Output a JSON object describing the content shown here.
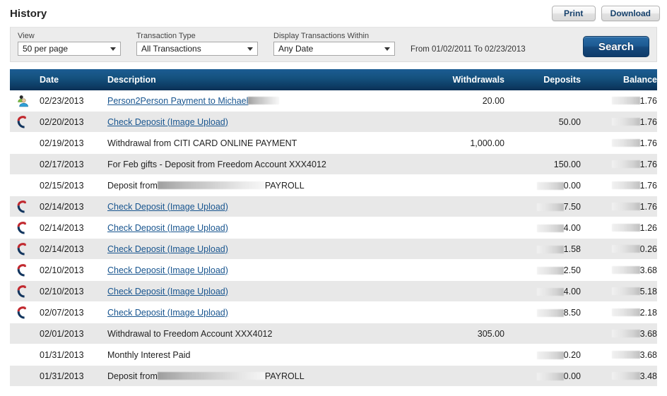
{
  "header": {
    "title": "History",
    "print_label": "Print",
    "download_label": "Download"
  },
  "filters": {
    "view": {
      "label": "View",
      "value": "50 per page"
    },
    "transaction_type": {
      "label": "Transaction Type",
      "value": "All Transactions"
    },
    "display_within": {
      "label": "Display Transactions Within",
      "value": "Any Date"
    },
    "date_range": "From 01/02/2011 To 02/23/2013",
    "search_label": "Search"
  },
  "table": {
    "columns": {
      "date": "Date",
      "description": "Description",
      "withdrawals": "Withdrawals",
      "deposits": "Deposits",
      "balance": "Balance"
    },
    "rows": [
      {
        "icon": "person2person-icon",
        "date": "02/23/2013",
        "description": "Person2Person Payment to Michael",
        "description_redacted": true,
        "is_link": true,
        "withdrawal": "20.00",
        "deposit": "",
        "deposit_redacted": false,
        "balance": "1.76",
        "balance_redacted": true,
        "stripe": "plain"
      },
      {
        "icon": "check-deposit-icon",
        "date": "02/20/2013",
        "description": "Check Deposit (Image Upload)",
        "description_redacted": false,
        "is_link": true,
        "withdrawal": "",
        "deposit": "50.00",
        "deposit_redacted": false,
        "balance": "1.76",
        "balance_redacted": true,
        "stripe": "alt"
      },
      {
        "icon": "",
        "date": "02/19/2013",
        "description": "Withdrawal from CITI CARD ONLINE PAYMENT",
        "description_redacted": false,
        "is_link": false,
        "withdrawal": "1,000.00",
        "deposit": "",
        "deposit_redacted": false,
        "balance": "1.76",
        "balance_redacted": true,
        "stripe": "plain"
      },
      {
        "icon": "",
        "date": "02/17/2013",
        "description": "For Feb gifts - Deposit from Freedom Account XXX4012",
        "description_redacted": false,
        "is_link": false,
        "withdrawal": "",
        "deposit": "150.00",
        "deposit_redacted": false,
        "balance": "1.76",
        "balance_redacted": true,
        "stripe": "alt"
      },
      {
        "icon": "",
        "date": "02/15/2013",
        "description": "Deposit from",
        "description_suffix": "PAYROLL",
        "description_redacted": true,
        "is_link": false,
        "withdrawal": "",
        "deposit": "0.00",
        "deposit_redacted": true,
        "balance": "1.76",
        "balance_redacted": true,
        "stripe": "plain"
      },
      {
        "icon": "check-deposit-icon",
        "date": "02/14/2013",
        "description": "Check Deposit (Image Upload)",
        "description_redacted": false,
        "is_link": true,
        "withdrawal": "",
        "deposit": "7.50",
        "deposit_redacted": true,
        "balance": "1.76",
        "balance_redacted": true,
        "stripe": "alt"
      },
      {
        "icon": "check-deposit-icon",
        "date": "02/14/2013",
        "description": "Check Deposit (Image Upload)",
        "description_redacted": false,
        "is_link": true,
        "withdrawal": "",
        "deposit": "4.00",
        "deposit_redacted": true,
        "balance": "1.26",
        "balance_redacted": true,
        "stripe": "plain"
      },
      {
        "icon": "check-deposit-icon",
        "date": "02/14/2013",
        "description": "Check Deposit (Image Upload)",
        "description_redacted": false,
        "is_link": true,
        "withdrawal": "",
        "deposit": "1.58",
        "deposit_redacted": true,
        "balance": "0.26",
        "balance_redacted": true,
        "stripe": "alt"
      },
      {
        "icon": "check-deposit-icon",
        "date": "02/10/2013",
        "description": "Check Deposit (Image Upload)",
        "description_redacted": false,
        "is_link": true,
        "withdrawal": "",
        "deposit": "2.50",
        "deposit_redacted": true,
        "balance": "3.68",
        "balance_redacted": true,
        "stripe": "plain"
      },
      {
        "icon": "check-deposit-icon",
        "date": "02/10/2013",
        "description": "Check Deposit (Image Upload)",
        "description_redacted": false,
        "is_link": true,
        "withdrawal": "",
        "deposit": "4.00",
        "deposit_redacted": true,
        "balance": "5.18",
        "balance_redacted": true,
        "stripe": "alt"
      },
      {
        "icon": "check-deposit-icon",
        "date": "02/07/2013",
        "description": "Check Deposit (Image Upload)",
        "description_redacted": false,
        "is_link": true,
        "withdrawal": "",
        "deposit": "8.50",
        "deposit_redacted": true,
        "balance": "2.18",
        "balance_redacted": true,
        "stripe": "plain"
      },
      {
        "icon": "",
        "date": "02/01/2013",
        "description": "Withdrawal to Freedom Account XXX4012",
        "description_redacted": false,
        "is_link": false,
        "withdrawal": "305.00",
        "deposit": "",
        "deposit_redacted": false,
        "balance": "3.68",
        "balance_redacted": true,
        "stripe": "alt"
      },
      {
        "icon": "",
        "date": "01/31/2013",
        "description": "Monthly Interest Paid",
        "description_redacted": false,
        "is_link": false,
        "withdrawal": "",
        "deposit": "0.20",
        "deposit_redacted": true,
        "balance": "3.68",
        "balance_redacted": true,
        "stripe": "plain"
      },
      {
        "icon": "",
        "date": "01/31/2013",
        "description": "Deposit from",
        "description_suffix": "PAYROLL",
        "description_redacted": true,
        "is_link": false,
        "withdrawal": "",
        "deposit": "0.00",
        "deposit_redacted": true,
        "balance": "3.48",
        "balance_redacted": true,
        "stripe": "alt"
      }
    ]
  },
  "colors": {
    "header_navy": "#0e3f68",
    "link_blue": "#18558f",
    "search_blue": "#1d5a92",
    "stripe_gray": "#e8e8e8",
    "filter_gray": "#ececec"
  }
}
